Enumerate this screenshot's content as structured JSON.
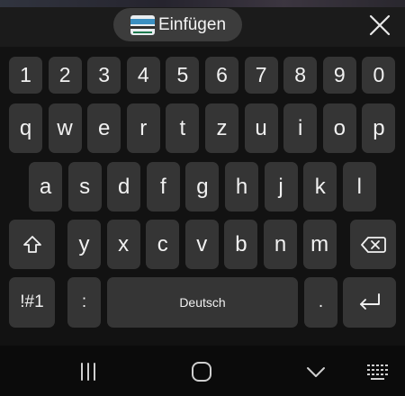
{
  "clipboard": {
    "label": "Einfügen",
    "icon": "clipboard-thumbnail-icon"
  },
  "close_icon": "close-icon",
  "keyboard": {
    "number_row": [
      "1",
      "2",
      "3",
      "4",
      "5",
      "6",
      "7",
      "8",
      "9",
      "0"
    ],
    "row1": [
      "q",
      "w",
      "e",
      "r",
      "t",
      "z",
      "u",
      "i",
      "o",
      "p"
    ],
    "row2": [
      "a",
      "s",
      "d",
      "f",
      "g",
      "h",
      "j",
      "k",
      "l"
    ],
    "row3": [
      "y",
      "x",
      "c",
      "v",
      "b",
      "n",
      "m"
    ],
    "shift_icon": "shift-icon",
    "backspace_icon": "backspace-icon",
    "symbols_label": "!#1",
    "colon_label": ":",
    "space_label": "Deutsch",
    "period_label": ".",
    "enter_icon": "enter-icon"
  },
  "navigation": {
    "recents_icon": "recent-apps-icon",
    "home_icon": "home-icon",
    "hide_keyboard_icon": "chevron-down-icon",
    "keyboard_switch_icon": "keyboard-icon"
  },
  "colors": {
    "key_bg": "#353535",
    "keyboard_bg": "#121212",
    "topbar_bg": "#1b1b1b",
    "chip_bg": "#3c3c3c"
  }
}
